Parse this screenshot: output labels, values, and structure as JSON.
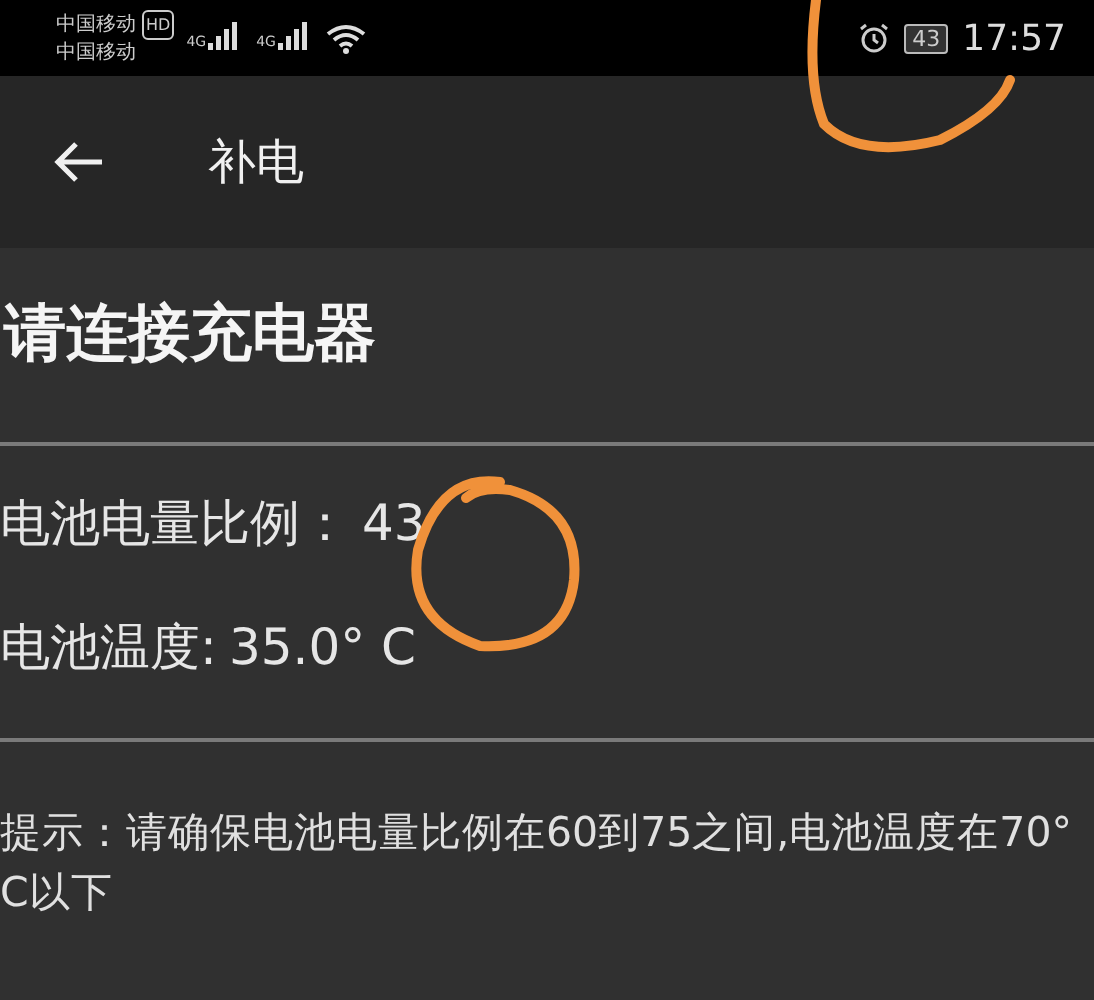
{
  "status_bar": {
    "carriers": [
      "中国移动",
      "中国移动"
    ],
    "hd_badge": "HD",
    "network_labels": [
      "4G",
      "4G"
    ],
    "battery": "43",
    "time": "17:57"
  },
  "app_bar": {
    "title": "补电"
  },
  "heading": "请连接充电器",
  "readings": [
    {
      "label": "电池电量比例：",
      "value": "43"
    },
    {
      "label": "电池温度:",
      "value": "35.0° C"
    }
  ],
  "hint": "提示：请确保电池电量比例在60到75之间,电池温度在70° C以下"
}
